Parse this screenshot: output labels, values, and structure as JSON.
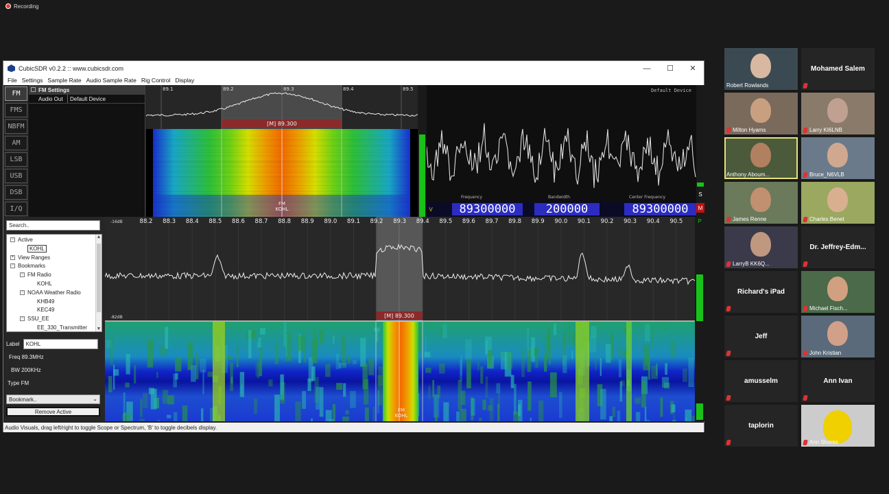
{
  "recording": {
    "label": "Recording"
  },
  "window": {
    "title": "CubicSDR v0.2.2 :: www.cubicsdr.com",
    "menu": [
      "File",
      "Settings",
      "Sample Rate",
      "Audio Sample Rate",
      "Rig Control",
      "Display"
    ]
  },
  "modes": [
    {
      "label": "FM",
      "active": true
    },
    {
      "label": "FMS",
      "active": false
    },
    {
      "label": "NBFM",
      "active": false
    },
    {
      "label": "AM",
      "active": false
    },
    {
      "label": "LSB",
      "active": false
    },
    {
      "label": "USB",
      "active": false
    },
    {
      "label": "DSB",
      "active": false
    },
    {
      "label": "I/Q",
      "active": false
    }
  ],
  "fm_settings": {
    "header": "FM Settings",
    "audio_out_label": "Audio Out",
    "audio_out_value": "Default Device"
  },
  "top_spectrum": {
    "ticks": [
      "89.1",
      "89.2",
      "89.3",
      "89.4",
      "89.5"
    ],
    "marker_label": "[M]  89.300",
    "waterfall_label_1": "FM",
    "waterfall_label_2": "KOHL"
  },
  "scope": {
    "device": "Default Device"
  },
  "freq_bar": {
    "v_label": "V",
    "frequency_label": "Frequency",
    "frequency_value": "89300000",
    "bandwidth_label": "Bandwidth",
    "bandwidth_value": "200000",
    "center_label": "Center Frequency",
    "center_value": "89300000",
    "s_label": "S",
    "m_label": "M",
    "p_label": "P"
  },
  "main_spectrum": {
    "db_top": "-16dB",
    "db_bottom": "-82dB",
    "ticks": [
      "88.2",
      "88.3",
      "88.4",
      "88.5",
      "88.6",
      "88.7",
      "88.8",
      "88.9",
      "89.0",
      "89.1",
      "89.2",
      "89.3",
      "89.4",
      "89.5",
      "89.6",
      "89.7",
      "89.8",
      "89.9",
      "90.0",
      "90.1",
      "90.2",
      "90.3",
      "90.4",
      "90.5"
    ],
    "marker_label": "[M]  89.300",
    "waterfall_label_1": "FM",
    "waterfall_label_2": "KOHL"
  },
  "bookmarks": {
    "search_placeholder": "Search..",
    "tree": [
      {
        "label": "Active",
        "level": 0,
        "expander": "−"
      },
      {
        "label": "KOHL",
        "level": 1,
        "selected": true
      },
      {
        "label": "View Ranges",
        "level": 0,
        "expander": "+"
      },
      {
        "label": "Bookmarks",
        "level": 0,
        "expander": "−"
      },
      {
        "label": "FM Radio",
        "level": 1,
        "expander": "−"
      },
      {
        "label": "KOHL",
        "level": 2
      },
      {
        "label": "NOAA Weather Radio",
        "level": 1,
        "expander": "−"
      },
      {
        "label": "KHB49",
        "level": 2
      },
      {
        "label": "KEC49",
        "level": 2
      },
      {
        "label": "SSU_EE",
        "level": 1,
        "expander": "−"
      },
      {
        "label": "EE_330_Transmitter",
        "level": 2
      }
    ],
    "label_caption": "Label",
    "label_value": "KOHL",
    "freq_text": "Freq  89.3MHz",
    "bw_text": "BW  200KHz",
    "type_text": "Type  FM",
    "bookmark_select": "Bookmark..",
    "remove_button": "Remove Active"
  },
  "status_bar": "Audio Visuals, drag left/right to toggle Scope or Spectrum, 'B' to toggle decibels display.",
  "participants": [
    {
      "name": "Robert Rowlands",
      "video": true,
      "muted": false
    },
    {
      "name": "Mohamed Salem",
      "video": false,
      "muted": true
    },
    {
      "name": "Milton Hyams",
      "video": true,
      "muted": true
    },
    {
      "name": "Larry KI6LNB",
      "video": true,
      "muted": true
    },
    {
      "name": "Anthony Aboum...",
      "video": true,
      "muted": false,
      "speaking": true
    },
    {
      "name": "Bruce_N6VLB",
      "video": true,
      "muted": true
    },
    {
      "name": "James Renne",
      "video": true,
      "muted": true
    },
    {
      "name": "Charles Benet",
      "video": true,
      "muted": true
    },
    {
      "name": "LarryB KK6Q...",
      "video": true,
      "muted": true
    },
    {
      "name": "Dr. Jeffrey-Edm...",
      "video": false,
      "muted": true
    },
    {
      "name": "Richard's iPad",
      "video": false,
      "muted": true
    },
    {
      "name": "Michael Fisch...",
      "video": true,
      "muted": true
    },
    {
      "name": "Jeff",
      "video": false,
      "muted": true
    },
    {
      "name": "John Kristian",
      "video": true,
      "muted": true
    },
    {
      "name": "amusselm",
      "video": false,
      "muted": true
    },
    {
      "name": "Ann Ivan",
      "video": false,
      "muted": true
    },
    {
      "name": "taplorin",
      "video": false,
      "muted": true
    },
    {
      "name": "Ann Shores",
      "video": true,
      "muted": true
    }
  ]
}
